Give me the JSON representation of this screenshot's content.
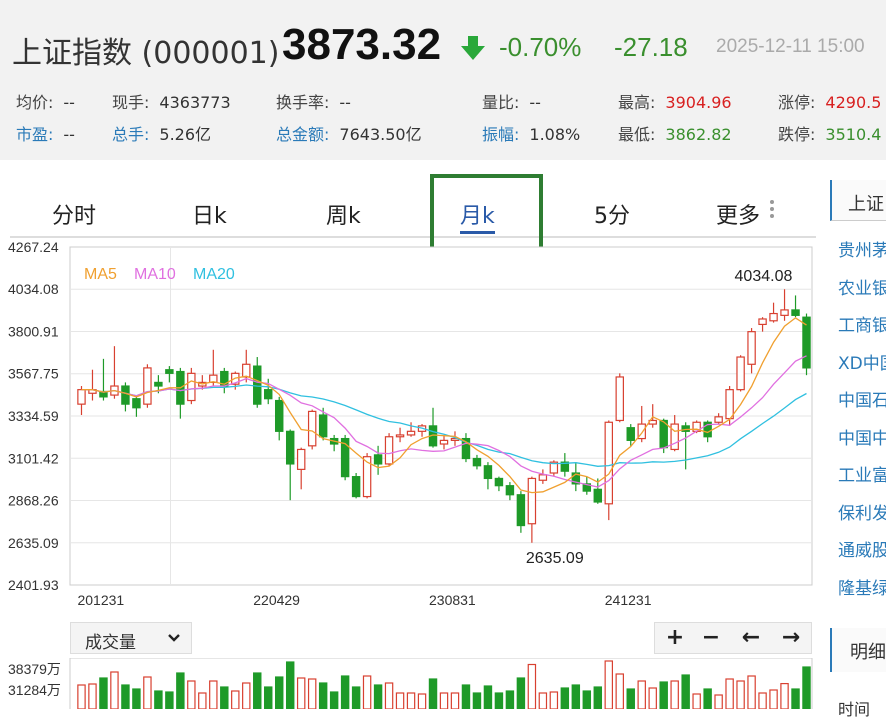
{
  "quote": {
    "name": "上证指数 (000001)",
    "price": "3873.32",
    "change_pct": "-0.70%",
    "change": "-27.18",
    "datetime": "2025-12-11 15:00"
  },
  "stats": [
    {
      "label": "均价:",
      "value": "--",
      "label_link": false,
      "color": ""
    },
    {
      "label": "现手:",
      "value": "4363773",
      "label_link": false,
      "color": ""
    },
    {
      "label": "换手率:",
      "value": "--",
      "label_link": false,
      "color": ""
    },
    {
      "label": "量比:",
      "value": "--",
      "label_link": false,
      "color": ""
    },
    {
      "label": "最高:",
      "value": "3904.96",
      "label_link": false,
      "color": "red"
    },
    {
      "label": "涨停:",
      "value": "4290.5",
      "label_link": false,
      "color": "red"
    },
    {
      "label": "市盈:",
      "value": "--",
      "label_link": true,
      "color": ""
    },
    {
      "label": "总手:",
      "value": "5.26亿",
      "label_link": true,
      "color": ""
    },
    {
      "label": "总金额:",
      "value": "7643.50亿",
      "label_link": true,
      "color": ""
    },
    {
      "label": "振幅:",
      "value": "1.08%",
      "label_link": true,
      "color": ""
    },
    {
      "label": "最低:",
      "value": "3862.82",
      "label_link": false,
      "color": "green"
    },
    {
      "label": "跌停:",
      "value": "3510.4",
      "label_link": false,
      "color": "green"
    }
  ],
  "tabs": [
    {
      "label": "分时",
      "active": false
    },
    {
      "label": "日k",
      "active": false
    },
    {
      "label": "周k",
      "active": false
    },
    {
      "label": "月k",
      "active": true
    },
    {
      "label": "5分",
      "active": false
    },
    {
      "label": "更多",
      "active": false
    }
  ],
  "colors": {
    "up": "#d84030",
    "down": "#1e9a28",
    "ma5": "#f0a030",
    "ma10": "#e070e0",
    "ma20": "#30c0e0",
    "accent": "#2e7d32"
  },
  "chart_data": {
    "type": "candlestick",
    "y_ticks": [
      "4267.24",
      "4034.08",
      "3800.91",
      "3567.75",
      "3334.59",
      "3101.42",
      "2868.26",
      "2635.09",
      "2401.93"
    ],
    "ylim": [
      2401.93,
      4267.24
    ],
    "x_ticks": [
      "201231",
      "220429",
      "230831",
      "241231"
    ],
    "legend": [
      "MA5",
      "MA10",
      "MA20"
    ],
    "max_label": "4034.08",
    "min_label": "2635.09",
    "candles": [
      [
        3400,
        3480,
        3340,
        3500
      ],
      [
        3460,
        3480,
        3420,
        3590
      ],
      [
        3470,
        3440,
        3420,
        3650
      ],
      [
        3450,
        3500,
        3430,
        3720
      ],
      [
        3500,
        3400,
        3360,
        3520
      ],
      [
        3430,
        3380,
        3330,
        3450
      ],
      [
        3400,
        3600,
        3380,
        3620
      ],
      [
        3520,
        3500,
        3460,
        3560
      ],
      [
        3590,
        3570,
        3520,
        3610
      ],
      [
        3580,
        3400,
        3320,
        3600
      ],
      [
        3420,
        3570,
        3400,
        3600
      ],
      [
        3500,
        3520,
        3480,
        3560
      ],
      [
        3520,
        3560,
        3500,
        3700
      ],
      [
        3580,
        3500,
        3460,
        3600
      ],
      [
        3510,
        3570,
        3480,
        3580
      ],
      [
        3550,
        3620,
        3520,
        3700
      ],
      [
        3610,
        3400,
        3380,
        3660
      ],
      [
        3480,
        3430,
        3400,
        3540
      ],
      [
        3420,
        3250,
        3200,
        3440
      ],
      [
        3250,
        3070,
        2870,
        3260
      ],
      [
        3040,
        3150,
        2930,
        3160
      ],
      [
        3170,
        3360,
        3150,
        3370
      ],
      [
        3340,
        3220,
        3200,
        3380
      ],
      [
        3210,
        3180,
        3140,
        3230
      ],
      [
        3210,
        3000,
        2980,
        3230
      ],
      [
        3000,
        2890,
        2880,
        3020
      ],
      [
        2890,
        3110,
        2880,
        3130
      ],
      [
        3120,
        3070,
        3010,
        3170
      ],
      [
        3070,
        3220,
        3060,
        3240
      ],
      [
        3220,
        3230,
        3190,
        3270
      ],
      [
        3230,
        3250,
        3220,
        3300
      ],
      [
        3250,
        3280,
        3220,
        3290
      ],
      [
        3280,
        3170,
        3160,
        3380
      ],
      [
        3180,
        3200,
        3150,
        3230
      ],
      [
        3200,
        3210,
        3170,
        3250
      ],
      [
        3210,
        3100,
        3080,
        3240
      ],
      [
        3100,
        3060,
        3040,
        3120
      ],
      [
        3060,
        2990,
        2930,
        3080
      ],
      [
        2990,
        2950,
        2920,
        3000
      ],
      [
        2950,
        2900,
        2870,
        2970
      ],
      [
        2900,
        2730,
        2690,
        2920
      ],
      [
        2740,
        2990,
        2635,
        3000
      ],
      [
        2980,
        3010,
        2960,
        3040
      ],
      [
        3020,
        3080,
        3000,
        3090
      ],
      [
        3080,
        3030,
        3000,
        3130
      ],
      [
        3020,
        2960,
        2920,
        3080
      ],
      [
        2960,
        2920,
        2900,
        3000
      ],
      [
        2930,
        2860,
        2850,
        2990
      ],
      [
        2850,
        3300,
        2760,
        3310
      ],
      [
        3310,
        3550,
        3300,
        3570
      ],
      [
        3270,
        3200,
        3170,
        3290
      ],
      [
        3210,
        3290,
        3190,
        3390
      ],
      [
        3290,
        3310,
        3270,
        3400
      ],
      [
        3310,
        3160,
        3130,
        3320
      ],
      [
        3150,
        3290,
        3140,
        3340
      ],
      [
        3280,
        3250,
        3040,
        3300
      ],
      [
        3250,
        3300,
        3240,
        3310
      ],
      [
        3300,
        3220,
        3190,
        3310
      ],
      [
        3300,
        3330,
        3290,
        3350
      ],
      [
        3320,
        3480,
        3280,
        3500
      ],
      [
        3480,
        3660,
        3470,
        3670
      ],
      [
        3620,
        3800,
        3570,
        3820
      ],
      [
        3840,
        3870,
        3800,
        3880
      ],
      [
        3860,
        3900,
        3850,
        3960
      ],
      [
        3890,
        3920,
        3860,
        4034.08
      ],
      [
        3920,
        3890,
        3880,
        4000
      ],
      [
        3880,
        3600,
        3560,
        3900
      ]
    ]
  },
  "volume": {
    "selector_label": "成交量",
    "y_ticks": [
      "38379万",
      "31284万"
    ],
    "controls": [
      "+",
      "−",
      "←",
      "→"
    ]
  },
  "sidebar": {
    "header": "上证",
    "items": [
      "贵州茅",
      "农业银",
      "工商银",
      "XD中国",
      "中国石",
      "中国中",
      "工业富",
      "保利发",
      "通威股",
      "隆基绿"
    ],
    "header2": "明细",
    "time_label": "时间"
  }
}
